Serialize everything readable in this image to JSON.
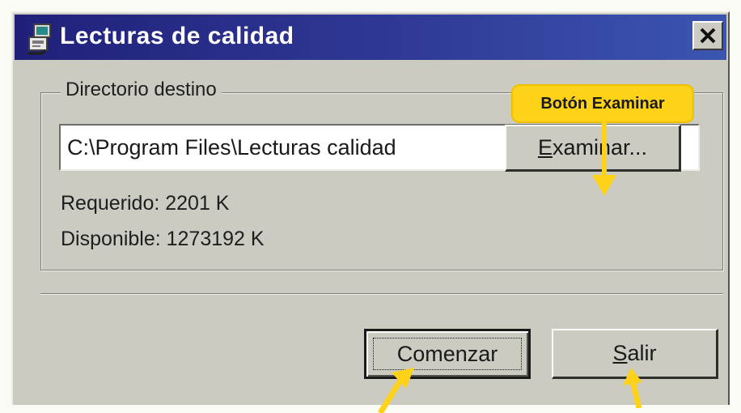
{
  "window": {
    "title": "Lecturas de calidad"
  },
  "group": {
    "label": "Directorio destino",
    "path_value": "C:\\Program Files\\Lecturas calidad",
    "required_text": "Requerido: 2201 K",
    "available_text": "Disponible: 1273192 K"
  },
  "buttons": {
    "browse_label": "Examinar...",
    "browse_mnemonic": "E",
    "browse_rest": "xaminar...",
    "start_label": "Comenzar",
    "exit_mnemonic": "S",
    "exit_rest": "alir"
  },
  "annotations": {
    "browse_callout": "Botón Examinar"
  },
  "colors": {
    "title_bar_start": "#20207a",
    "title_bar_end": "#3b55b0",
    "dialog_face": "#cbcbc1",
    "callout": "#ffd21a"
  }
}
